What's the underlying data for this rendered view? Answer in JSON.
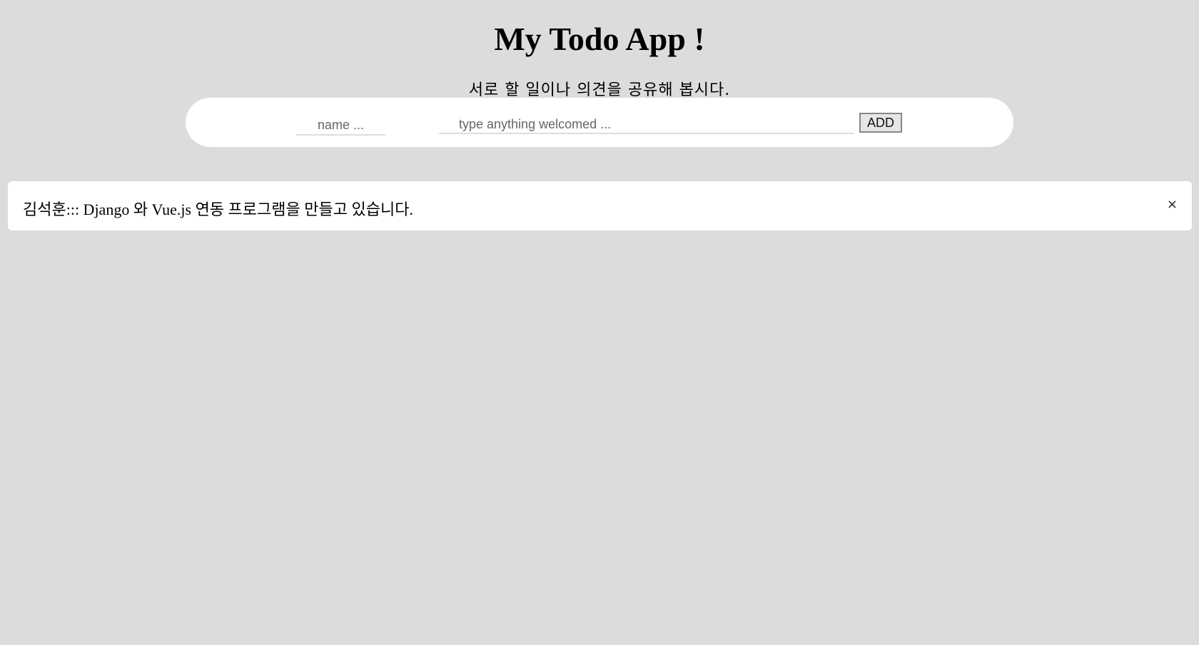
{
  "header": {
    "title": "My Todo App !",
    "subtitle": "서로 할 일이나 의견을 공유해 봅시다."
  },
  "form": {
    "name_placeholder": "name ...",
    "text_placeholder": "type anything welcomed ...",
    "add_label": "ADD"
  },
  "todos": [
    {
      "text": "김석훈::: Django 와 Vue.js 연동 프로그램을 만들고 있습니다.",
      "close": "×"
    }
  ]
}
